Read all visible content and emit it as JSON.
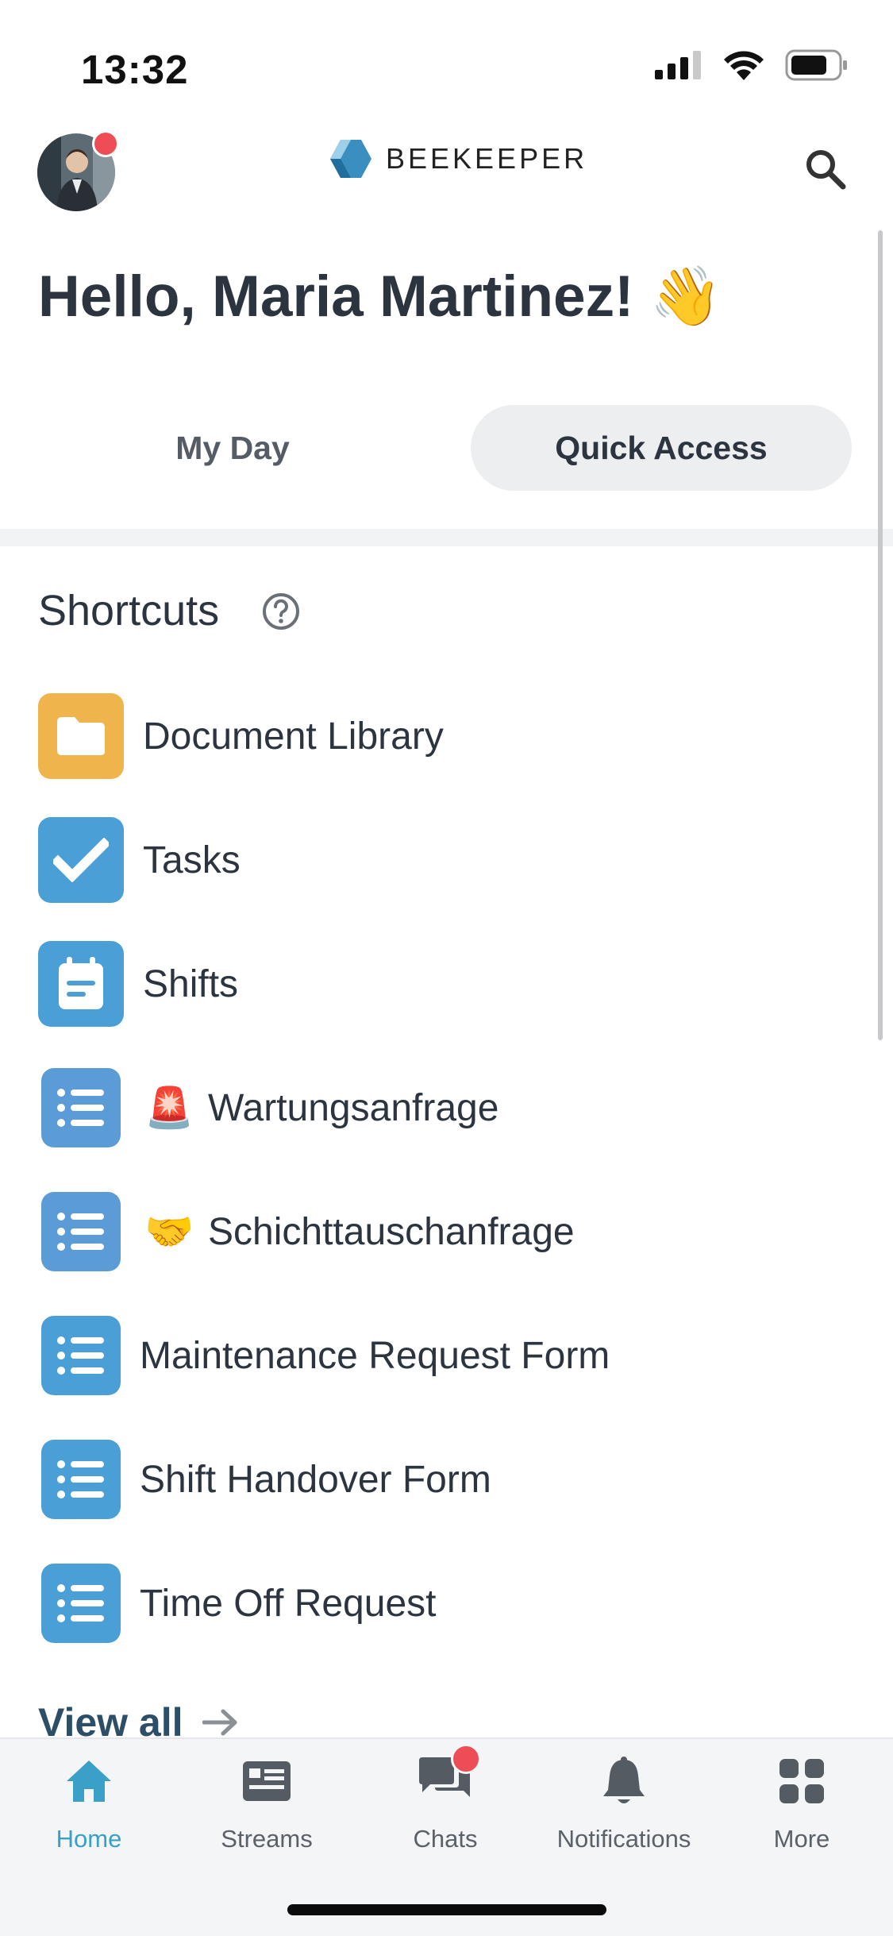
{
  "status_bar": {
    "time": "13:32"
  },
  "header": {
    "logo_text": "BEEKEEPER"
  },
  "greeting": {
    "text": "Hello, Maria Martinez! 👋"
  },
  "tabs": [
    {
      "label": "My Day",
      "selected": false
    },
    {
      "label": "Quick Access",
      "selected": true
    }
  ],
  "shortcuts": {
    "title": "Shortcuts",
    "items": [
      {
        "label": "Document Library",
        "icon": "folder-icon",
        "color": "#f0b44c"
      },
      {
        "label": "Tasks",
        "icon": "checkmark-icon",
        "color": "#4a9fd6"
      },
      {
        "label": "Shifts",
        "icon": "calendar-icon",
        "color": "#4a9fd6"
      },
      {
        "label": "Wartungsanfrage",
        "emoji": "🚨",
        "icon": "list-icon",
        "color": "#5b9bd6"
      },
      {
        "label": "Schichttauschanfrage",
        "emoji": "🤝",
        "icon": "list-icon",
        "color": "#5b9bd6"
      },
      {
        "label": "Maintenance Request Form",
        "icon": "list-icon",
        "color": "#4a9fd6"
      },
      {
        "label": "Shift Handover Form",
        "icon": "list-icon",
        "color": "#4a9fd6"
      },
      {
        "label": "Time Off Request",
        "icon": "list-icon",
        "color": "#4a9fd6"
      }
    ],
    "view_all": "View all"
  },
  "bottom_nav": [
    {
      "label": "Home",
      "icon": "home-icon",
      "active": true,
      "color": "#3aa0c8"
    },
    {
      "label": "Streams",
      "icon": "streams-icon",
      "active": false
    },
    {
      "label": "Chats",
      "icon": "chats-icon",
      "active": false
    },
    {
      "label": "Notifications",
      "icon": "bell-icon",
      "active": false
    },
    {
      "label": "More",
      "icon": "grid-icon",
      "active": false
    }
  ]
}
